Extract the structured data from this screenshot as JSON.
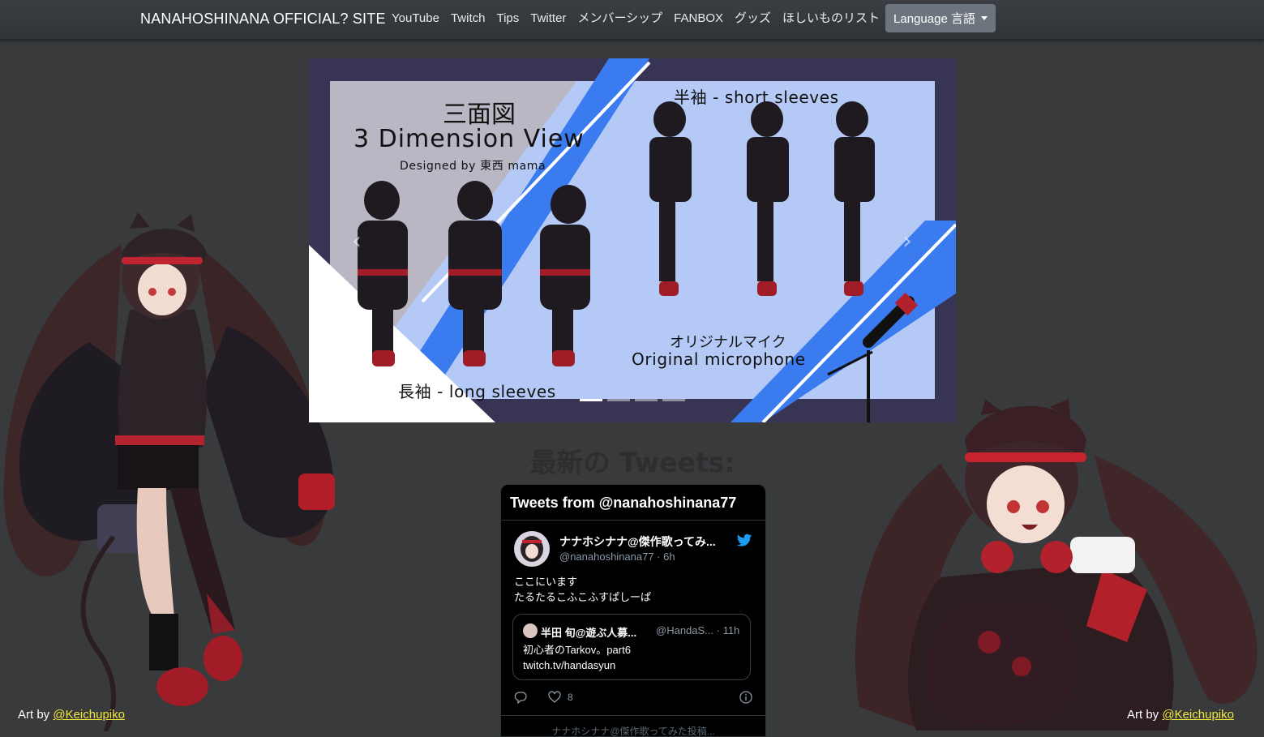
{
  "navbar": {
    "brand": "NANAHOSHINANA OFFICIAL? SITE",
    "links": [
      "YouTube",
      "Twitch",
      "Tips",
      "Twitter",
      "メンバーシップ",
      "FANBOX",
      "グッズ",
      "ほしいものリスト"
    ],
    "language_button": "Language 言語"
  },
  "carousel": {
    "slide_title_jp": "三面図",
    "slide_title_en": "3 Dimension View",
    "slide_designer": "Designed by 東西 mama",
    "short_sleeves": "半袖 - short sleeves",
    "long_sleeves": "長袖 - long sleeves",
    "mic_jp": "オリジナルマイク",
    "mic_en": "Original microphone",
    "slide_count": 4,
    "active_index": 0
  },
  "tweets": {
    "heading": "最新の Tweets:",
    "widget_title": "Tweets from @nanahoshinana77",
    "author_name": "ナナホシナナ@傑作歌ってみ...",
    "author_handle": "@nanahoshinana77 · 6h",
    "text_line1": "ここにいます",
    "text_line2": "たるたるこふこふすぱしーぱ",
    "quote_name": "半田 旬@遊ぶ人募...",
    "quote_handle": "@HandaS... · 11h",
    "quote_line1": "初心者のTarkov。part6",
    "quote_line2": "twitch.tv/handasyun",
    "like_count": "8",
    "footer_text": "ナナホシナナ@傑作歌ってみた投稿..."
  },
  "credits": {
    "left_prefix": "Art by ",
    "left_handle": "@Keichupiko",
    "right_prefix": "Art by ",
    "right_handle": "@Keichupiko"
  },
  "colors": {
    "page_bg": "#383a3c",
    "accent_blue": "#3a7bf0",
    "link_yellow": "#f0e63c",
    "language_btn": "#6c757d"
  }
}
